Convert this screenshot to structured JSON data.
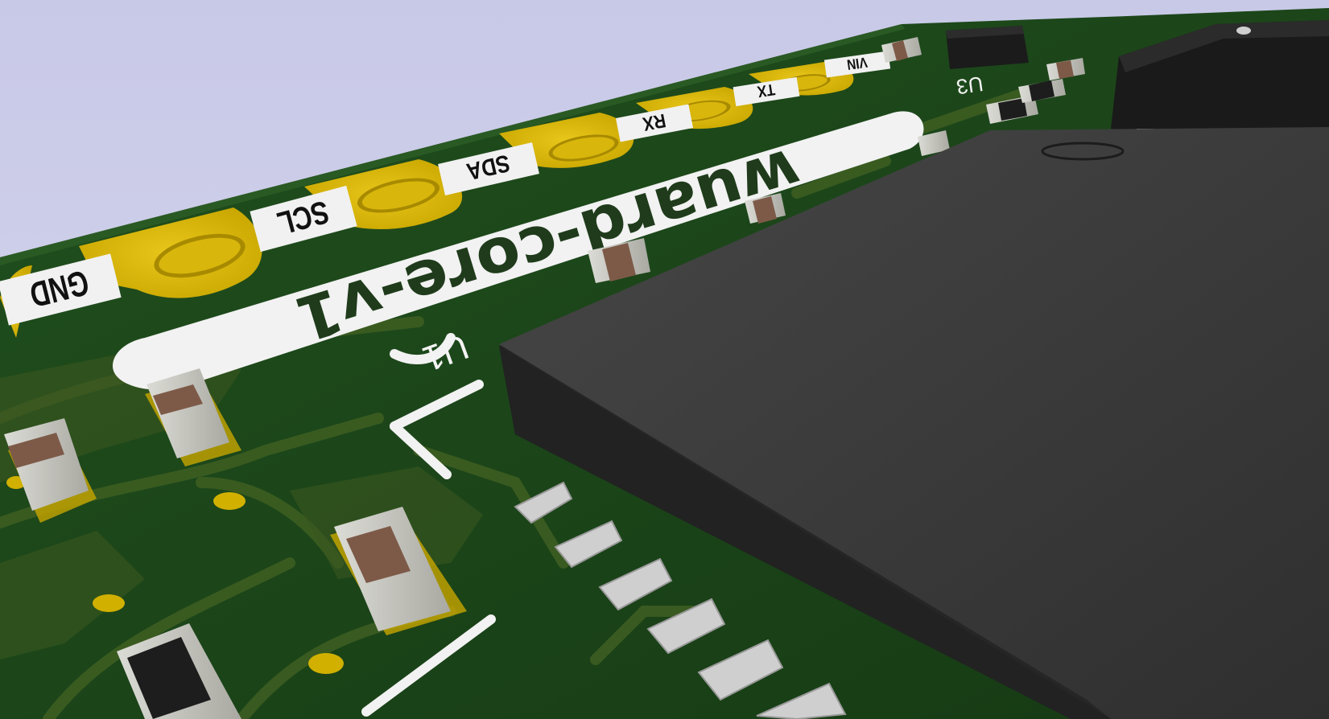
{
  "board": {
    "name": "wuard-core-v1",
    "pins": [
      "GND",
      "SCL",
      "SDA",
      "RX",
      "TX",
      "VIN"
    ],
    "refs": [
      "U1",
      "U3"
    ]
  },
  "colors": {
    "sky": "#c9cbe6",
    "board": "#1f4a1c",
    "trace": "#3d5a22",
    "pad": "#d1b000",
    "silkscreen": "#f1f1f1",
    "chip": "#3a3a3a"
  }
}
